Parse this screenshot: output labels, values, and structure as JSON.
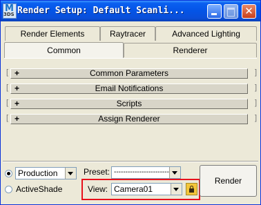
{
  "window": {
    "title": "Render Setup: Default Scanli...",
    "app_icon_letter": "M",
    "app_icon_subtext": "3DS",
    "close_glyph": "✕",
    "title_color": "#0454e6"
  },
  "tabs": {
    "row1": [
      "Render Elements",
      "Raytracer",
      "Advanced Lighting"
    ],
    "row2": [
      "Common",
      "Renderer"
    ],
    "active": "Common"
  },
  "rollouts": [
    {
      "label": "Common Parameters",
      "toggle": "+"
    },
    {
      "label": "Email Notifications",
      "toggle": "+"
    },
    {
      "label": "Scripts",
      "toggle": "+"
    },
    {
      "label": "Assign Renderer",
      "toggle": "+"
    }
  ],
  "bottom": {
    "production_label": "Production",
    "activeshade_label": "ActiveShade",
    "selected_mode": "Production",
    "preset_label": "Preset:",
    "preset_value": "------------------------",
    "view_label": "View:",
    "view_value": "Camera01",
    "render_label": "Render",
    "highlight_color": "#e8101a"
  },
  "icons": {
    "lock": "lock-icon",
    "minimize": "minimize-icon",
    "maximize": "maximize-icon",
    "close": "close-icon"
  }
}
